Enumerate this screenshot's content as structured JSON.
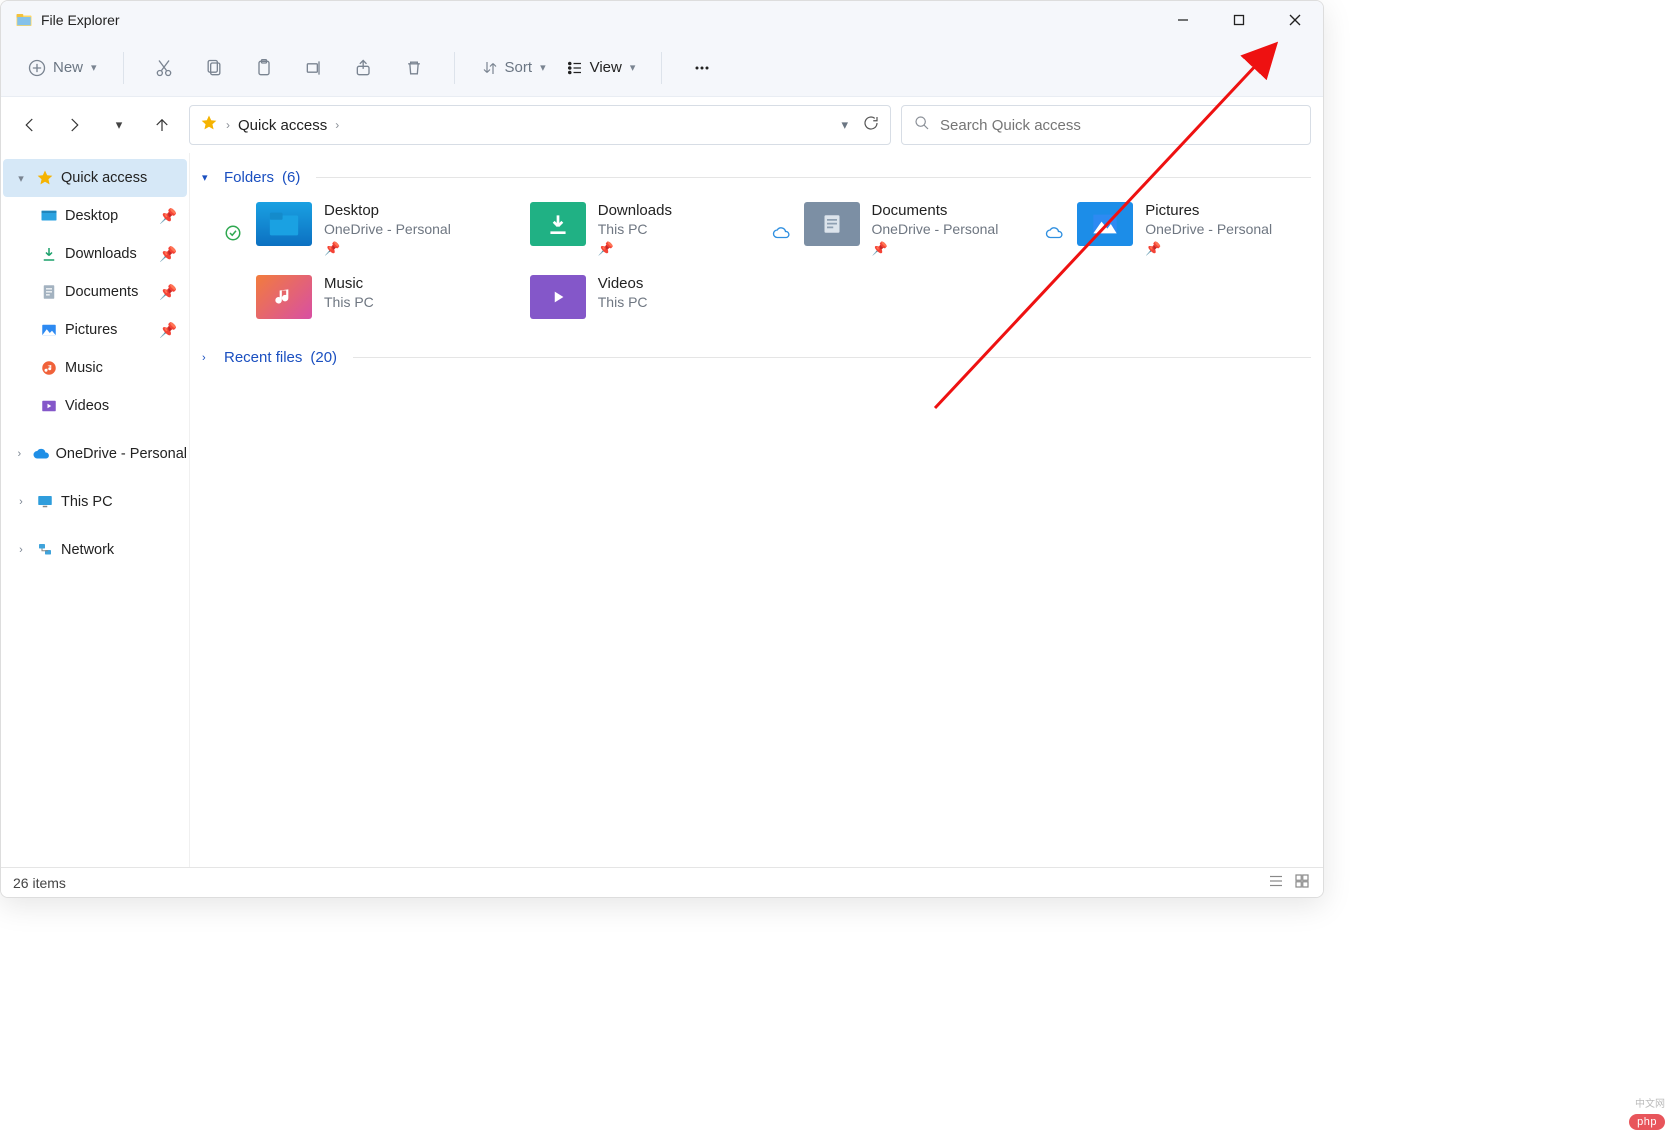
{
  "window": {
    "title": "File Explorer"
  },
  "toolbar": {
    "new_label": "New",
    "sort_label": "Sort",
    "view_label": "View"
  },
  "address": {
    "crumb1": "Quick access"
  },
  "search": {
    "placeholder": "Search Quick access"
  },
  "sidebar": {
    "quick_access": "Quick access",
    "items": [
      {
        "label": "Desktop"
      },
      {
        "label": "Downloads"
      },
      {
        "label": "Documents"
      },
      {
        "label": "Pictures"
      },
      {
        "label": "Music"
      },
      {
        "label": "Videos"
      }
    ],
    "onedrive": "OneDrive - Personal",
    "this_pc": "This PC",
    "network": "Network"
  },
  "sections": {
    "folders": {
      "label": "Folders",
      "count": "(6)"
    },
    "recent": {
      "label": "Recent files",
      "count": "(20)"
    }
  },
  "tiles": [
    {
      "name": "Desktop",
      "sub": "OneDrive - Personal"
    },
    {
      "name": "Downloads",
      "sub": "This PC"
    },
    {
      "name": "Documents",
      "sub": "OneDrive - Personal"
    },
    {
      "name": "Pictures",
      "sub": "OneDrive - Personal"
    },
    {
      "name": "Music",
      "sub": "This PC"
    },
    {
      "name": "Videos",
      "sub": "This PC"
    }
  ],
  "status": {
    "items": "26 items"
  },
  "watermark": {
    "main": "php",
    "sub": "中文网"
  }
}
